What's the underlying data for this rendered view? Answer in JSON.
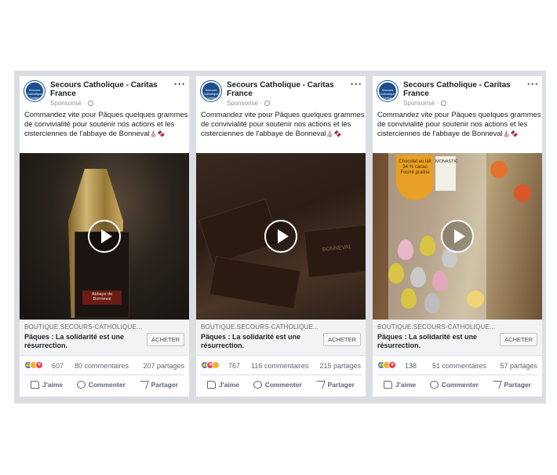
{
  "ads": [
    {
      "page_name": "Secours Catholique - Caritas France",
      "logo_text": "Secours Catholique Caritas France",
      "sponsored": "Sponsorisé · ",
      "text": "Commandez vite pour Pâques quelques grammes de convivialité pour soutenir nos actions et les cisterciennes de l'abbaye de Bonneval",
      "emojis": "⛪🍫",
      "domain": "BOUTIQUE.SECOURS-CATHOLIQUE...",
      "headline": "Pâques : La solidarité est une résurrection.",
      "cta": "ACHETER",
      "reaction_count": "607",
      "comments": "80 commentaires",
      "shares": "207 partages",
      "product_label": "Abbaye de Bonneval",
      "actions": {
        "like": "J'aime",
        "comment": "Commenter",
        "share": "Partager"
      }
    },
    {
      "page_name": "Secours Catholique - Caritas France",
      "logo_text": "Secours Catholique Caritas France",
      "sponsored": "Sponsorisé · ",
      "text": "Commandez vite pour Pâques quelques grammes de convivialité pour soutenir nos actions et les cisterciennes de l'abbaye de Bonneval",
      "emojis": "⛪🍫",
      "domain": "BOUTIQUE.SECOURS-CATHOLIQUE...",
      "headline": "Pâques : La solidarité est une résurrection.",
      "cta": "ACHETER",
      "reaction_count": "767",
      "comments": "116 commentaires",
      "shares": "215 partages",
      "product_label": "BONNEVAL",
      "actions": {
        "like": "J'aime",
        "comment": "Commenter",
        "share": "Partager"
      }
    },
    {
      "page_name": "Secours Catholique - Caritas France",
      "logo_text": "Secours Catholique Caritas France",
      "sponsored": "Sponsorisé · ",
      "text": "Commandez vite pour Pâques quelques grammes de convivialité pour soutenir nos actions et les cisterciennes de l'abbaye de Bonneval",
      "emojis": "⛪🍫",
      "domain": "BOUTIQUE.SECOURS-CATHOLIQUE...",
      "headline": "Pâques : La solidarité est une résurrection.",
      "cta": "ACHETER",
      "reaction_count": "138",
      "comments": "51 commentaires",
      "shares": "57 partages",
      "product_label": "Chocolat au lait 34 % cacao Fourré praliné",
      "product_label_2": "MONASTIC",
      "actions": {
        "like": "J'aime",
        "comment": "Commenter",
        "share": "Partager"
      }
    }
  ],
  "colors": {
    "like": "#2078f4",
    "love": "#f33e58",
    "wow": "#f7b125",
    "brand": "#1b4f8f"
  },
  "icons": [
    "more-icon",
    "globe-icon",
    "play-icon",
    "like-reaction-icon",
    "wow-reaction-icon",
    "love-reaction-icon",
    "thumb-icon",
    "comment-icon",
    "share-icon"
  ]
}
